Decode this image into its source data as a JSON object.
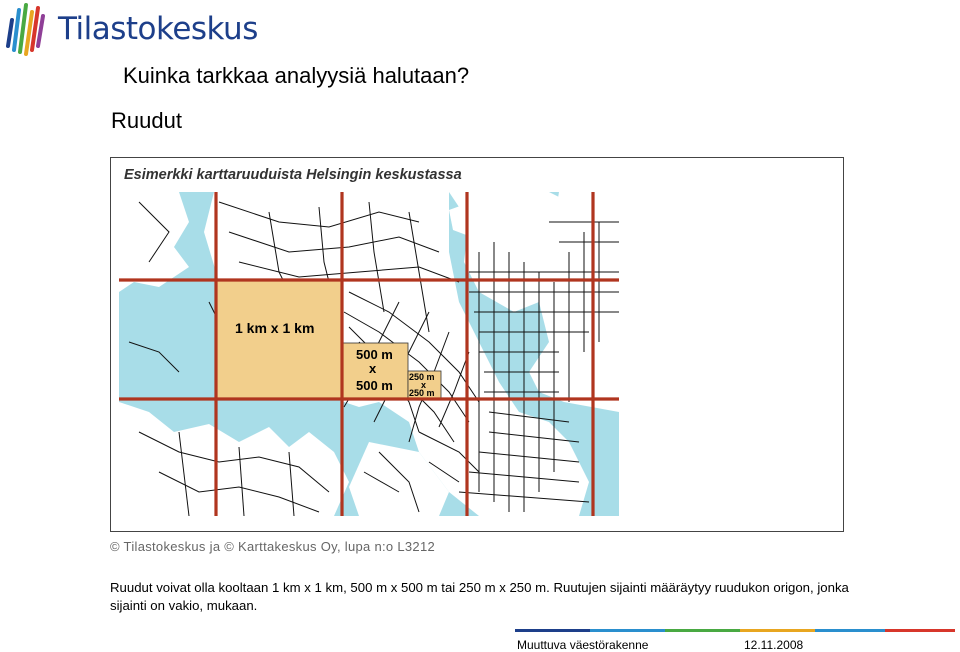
{
  "logo": {
    "text": "Tilastokeskus"
  },
  "question": "Kuinka tarkkaa analyysiä halutaan?",
  "subtitle": "Ruudut",
  "map": {
    "title": "Esimerkki karttaruuduista Helsingin keskustassa",
    "labels": {
      "km": "1 km x 1 km",
      "m500_top": "500 m",
      "m500_mid": "x",
      "m500_bot": "500 m",
      "m250_top": "250 m",
      "m250_mid": "x",
      "m250_bot": "250 m"
    },
    "colors": {
      "water": "#a8dde8",
      "land": "#ffffff",
      "grid": "#b0351f",
      "cell": "#f2cf8c",
      "streets": "#111111"
    }
  },
  "copyright": "© Tilastokeskus ja © Karttakeskus Oy, lupa n:o L3212",
  "description": "Ruudut voivat olla kooltaan 1 km x 1 km, 500 m x 500 m tai 250 m x 250 m. Ruutujen sijainti määräytyy ruudukon origon, jonka sijainti on vakio, mukaan.",
  "footer": {
    "title": "Muuttuva väestörakenne",
    "date": "12.11.2008"
  }
}
